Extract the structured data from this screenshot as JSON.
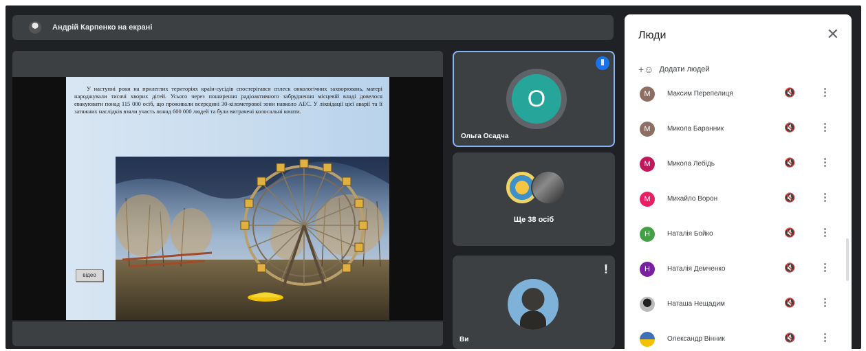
{
  "meeting": {
    "presenter_label": "Андрій Карпенко на екрані"
  },
  "slide": {
    "paragraph": "У наступні роки на прилеглих територіях країн-сусідів спостерігався сплеск онкологічних захворювань, матері народжували тисячі хворих дітей. Усього через поширення радіоактивного забруднення місцевій владі довелося евакуювати понад 115 000 осіб, що проживали всередині 30-кілометрової зони навколо АЕС. У ліквідації цієї аварії та її затяжних наслідків взяли участь понад 600 000 людей та були витрачені колосальні кошти.",
    "video_button": "відео"
  },
  "tiles": {
    "t1": {
      "initial": "О",
      "name": "Ольга Осадча",
      "avatar_color": "#26a69a"
    },
    "t2": {
      "more_label": "Ще 38 осіб"
    },
    "t3": {
      "name": "Ви",
      "alert": "!"
    }
  },
  "people_panel": {
    "title": "Люди",
    "close": "✕",
    "add_label": "Додати людей",
    "members": [
      {
        "initial": "М",
        "name": "Максим Перепелиця",
        "color": "#8d6e63"
      },
      {
        "initial": "М",
        "name": "Микола Баранник",
        "color": "#8d6e63"
      },
      {
        "initial": "М",
        "name": "Микола Лебідь",
        "color": "#c2185b"
      },
      {
        "initial": "М",
        "name": "Михайло Ворон",
        "color": "#e91e63"
      },
      {
        "initial": "Н",
        "name": "Наталія Бойко",
        "color": "#43a047"
      },
      {
        "initial": "Н",
        "name": "Наталія Демченко",
        "color": "#7b1fa2"
      },
      {
        "initial": "",
        "name": "Наташа Нещадим",
        "color": "#555555"
      },
      {
        "initial": "",
        "name": "Олександр Вінник",
        "color": "#3f6fb5"
      }
    ]
  }
}
